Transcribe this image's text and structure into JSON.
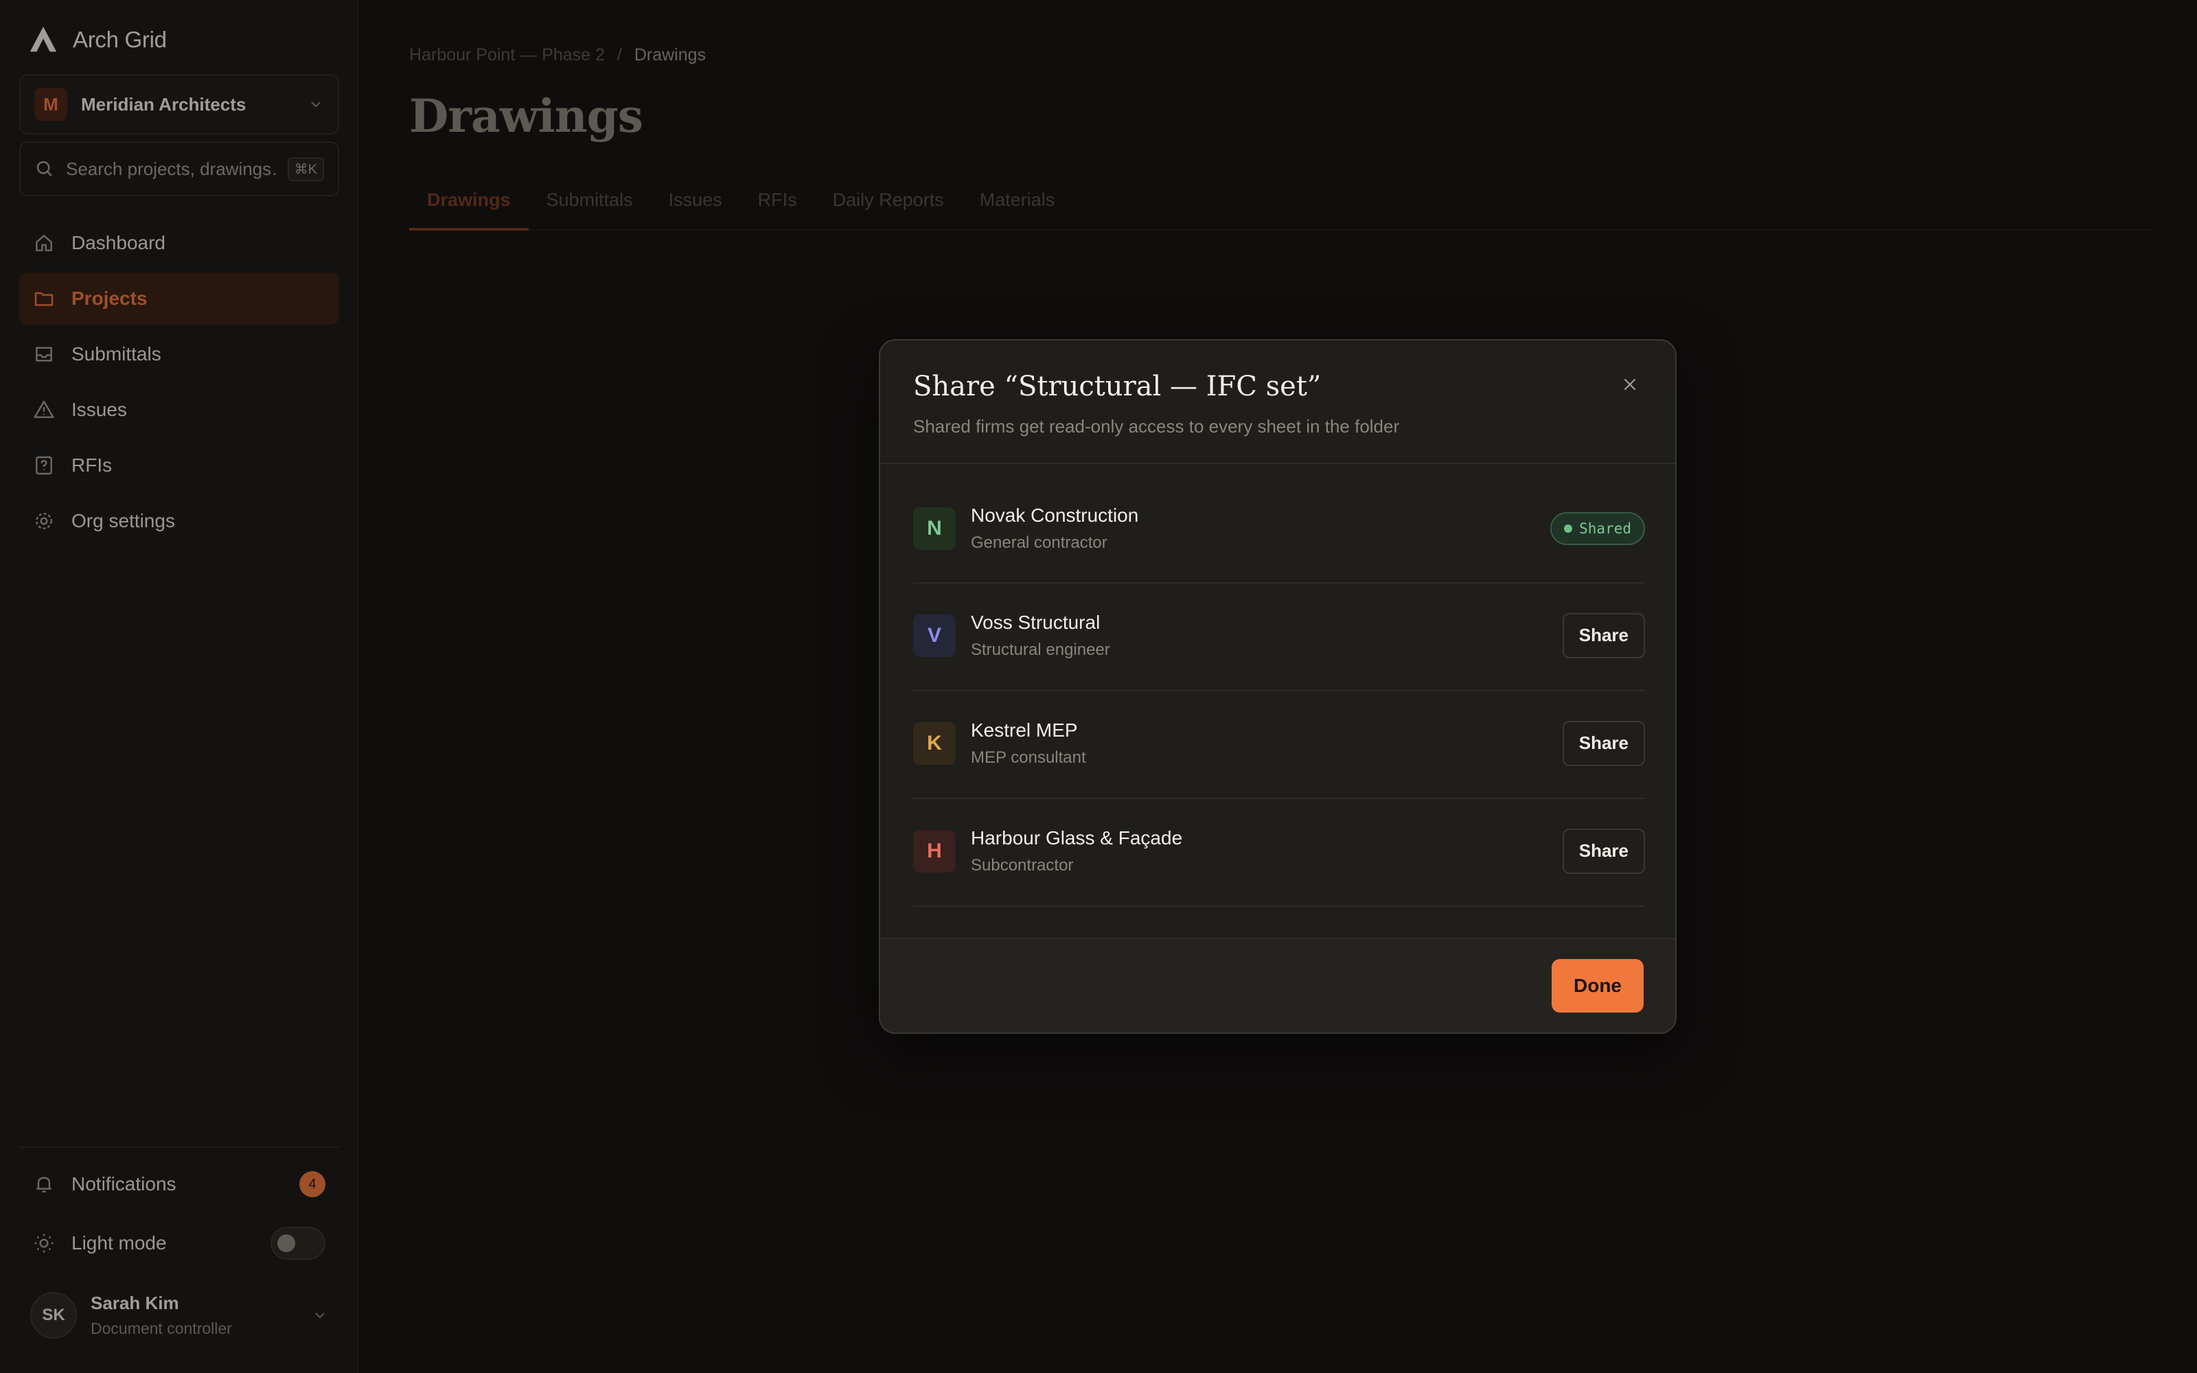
{
  "app": {
    "name": "Arch Grid",
    "logo_icon": "arch-logo-icon"
  },
  "org": {
    "initial": "M",
    "name": "Meridian Architects",
    "accent": "#f0783c"
  },
  "search": {
    "placeholder": "Search projects, drawings…",
    "shortcut": "⌘K"
  },
  "nav": {
    "items": [
      {
        "label": "Dashboard",
        "icon": "home-icon",
        "active": false
      },
      {
        "label": "Projects",
        "icon": "folder-icon",
        "active": true
      },
      {
        "label": "Submittals",
        "icon": "inbox-icon",
        "active": false
      },
      {
        "label": "Issues",
        "icon": "warning-icon",
        "active": false
      },
      {
        "label": "RFIs",
        "icon": "question-icon",
        "active": false
      },
      {
        "label": "Org settings",
        "icon": "gear-icon",
        "active": false
      }
    ]
  },
  "notifications": {
    "label": "Notifications",
    "count": "4"
  },
  "theme": {
    "label": "Light mode",
    "enabled": false
  },
  "user": {
    "initials": "SK",
    "name": "Sarah Kim",
    "role": "Document controller"
  },
  "breadcrumb": {
    "project": "Harbour Point — Phase 2",
    "separator": "/",
    "current": "Drawings"
  },
  "page": {
    "title": "Drawings"
  },
  "tabs": [
    "Drawings",
    "Submittals",
    "Issues",
    "RFIs",
    "Daily Reports",
    "Materials"
  ],
  "modal": {
    "title": "Share “Structural — IFC set”",
    "subtitle": "Shared firms get read-only access to every sheet in the folder",
    "firms": [
      {
        "initial": "N",
        "name": "Novak Construction",
        "role": "General contractor",
        "status": "Shared",
        "avatar_bg": "#22301f",
        "avatar_fg": "#7ec796"
      },
      {
        "initial": "V",
        "name": "Voss Structural",
        "role": "Structural engineer",
        "action": "Share",
        "avatar_bg": "#262639",
        "avatar_fg": "#8c8cf0"
      },
      {
        "initial": "K",
        "name": "Kestrel MEP",
        "role": "MEP consultant",
        "action": "Share",
        "avatar_bg": "#33291b",
        "avatar_fg": "#e0a94a"
      },
      {
        "initial": "H",
        "name": "Harbour Glass & Façade",
        "role": "Subcontractor",
        "action": "Share",
        "avatar_bg": "#3a201f",
        "avatar_fg": "#e87060"
      }
    ],
    "done_label": "Done"
  }
}
